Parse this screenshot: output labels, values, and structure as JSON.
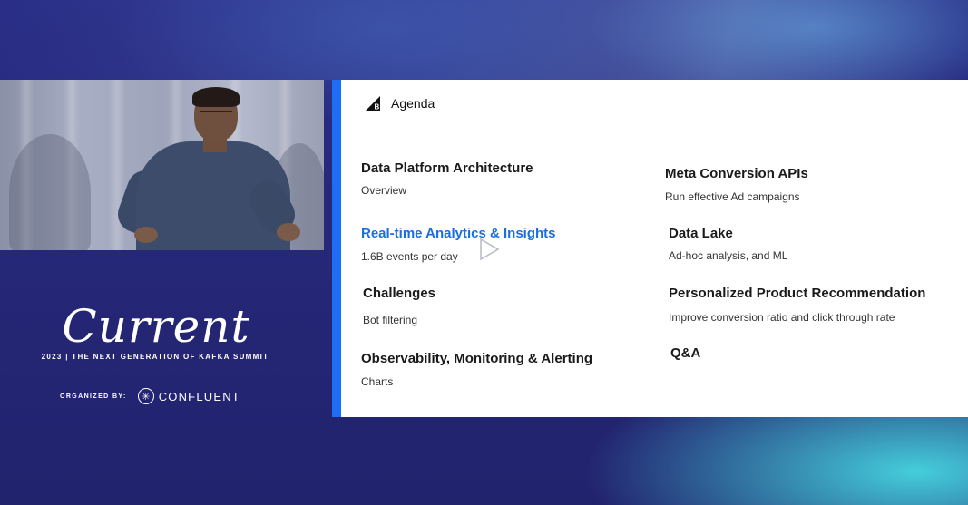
{
  "brand": {
    "logo_text": "Current",
    "tagline": "2023 | THE NEXT GENERATION OF KAFKA SUMMIT",
    "organized_label": "ORGANIZED BY:",
    "organizer": "CONFLUENT"
  },
  "slide": {
    "heading": "Agenda",
    "accent_color": "#1e6df5",
    "active_color": "#1a6fe0",
    "left": [
      {
        "title": "Data Platform Architecture",
        "subtitle": "Overview"
      },
      {
        "title": "Real-time Analytics & Insights",
        "subtitle": "1.6B events per day"
      },
      {
        "title": "Challenges",
        "subtitle": "Bot filtering"
      },
      {
        "title": "Observability, Monitoring & Alerting",
        "subtitle": "Charts"
      }
    ],
    "right": [
      {
        "title": "Meta Conversion APIs",
        "subtitle": "Run effective Ad campaigns"
      },
      {
        "title": "Data Lake",
        "subtitle": "Ad-hoc analysis, and ML"
      },
      {
        "title": "Personalized Product Recommendation",
        "subtitle": "Improve conversion ratio and click through rate"
      },
      {
        "title": "Q&A"
      }
    ]
  }
}
